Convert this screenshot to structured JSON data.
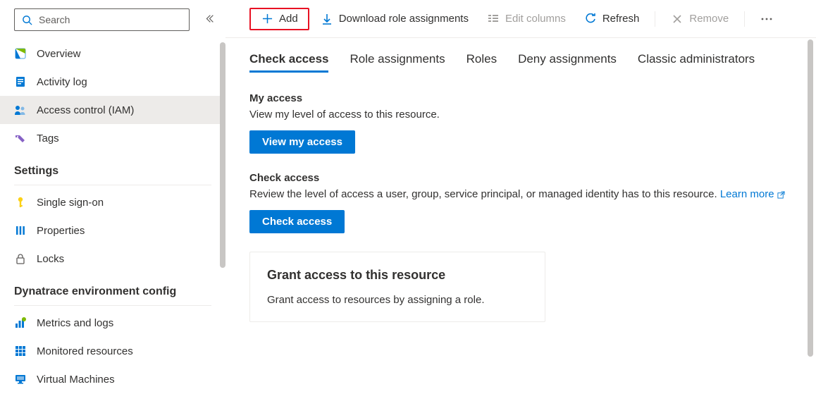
{
  "search": {
    "placeholder": "Search"
  },
  "sidebar": {
    "items": [
      {
        "label": "Overview",
        "icon": "overview"
      },
      {
        "label": "Activity log",
        "icon": "activity"
      },
      {
        "label": "Access control (IAM)",
        "icon": "access",
        "selected": true
      },
      {
        "label": "Tags",
        "icon": "tags"
      }
    ],
    "sections": [
      {
        "header": "Settings",
        "items": [
          {
            "label": "Single sign-on",
            "icon": "key"
          },
          {
            "label": "Properties",
            "icon": "properties"
          },
          {
            "label": "Locks",
            "icon": "lock"
          }
        ]
      },
      {
        "header": "Dynatrace environment config",
        "items": [
          {
            "label": "Metrics and logs",
            "icon": "metrics"
          },
          {
            "label": "Monitored resources",
            "icon": "grid"
          },
          {
            "label": "Virtual Machines",
            "icon": "vm"
          }
        ]
      }
    ]
  },
  "toolbar": {
    "add": "Add",
    "download": "Download role assignments",
    "edit_columns": "Edit columns",
    "refresh": "Refresh",
    "remove": "Remove"
  },
  "tabs": [
    "Check access",
    "Role assignments",
    "Roles",
    "Deny assignments",
    "Classic administrators"
  ],
  "my_access": {
    "title": "My access",
    "desc": "View my level of access to this resource.",
    "button": "View my access"
  },
  "check_access": {
    "title": "Check access",
    "desc": "Review the level of access a user, group, service principal, or managed identity has to this resource. ",
    "link": "Learn more",
    "button": "Check access"
  },
  "grant_card": {
    "title": "Grant access to this resource",
    "body": "Grant access to resources by assigning a role."
  }
}
